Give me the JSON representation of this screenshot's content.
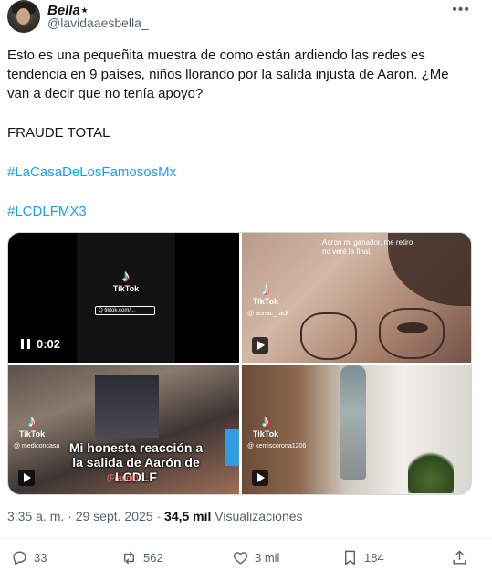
{
  "author": {
    "display_name": "Bella⋆",
    "handle": "@lavidaaesbella_"
  },
  "more_icon": "more-horizontal-icon",
  "tweet": {
    "line1": "Esto es una pequeñita muestra de como están ardiendo las redes es tendencia en 9 países, niños llorando por la salida injusta de Aaron. ¿Me van a decir que no tenía apoyo?",
    "line2": "FRAUDE TOTAL",
    "hashtag1": "#LaCasaDeLosFamososMx",
    "hashtag2": "#LCDLFMX3"
  },
  "media": {
    "tile1": {
      "brand": "TikTok",
      "search_text": "Q  tiktok.com/...",
      "time": "0:02"
    },
    "tile2": {
      "caption": "Aaron mi ganador, me retiro no veré la final.",
      "brand": "TikTok",
      "user": "@ annac_rack"
    },
    "tile3": {
      "brand": "TikTok",
      "user": "@ mediconcasa",
      "overlay": "Mi honesta reacción a la salida de Aarón de LCDLF",
      "sub": "(Fraude)"
    },
    "tile4": {
      "brand": "TikTok",
      "user": "@ kemiscorona1206"
    }
  },
  "meta": {
    "time": "3:35 a. m.",
    "sep": " · ",
    "date": "29 sept. 2025",
    "sep2": " · ",
    "views": "34,5 mil",
    "views_label": " Visualizaciones"
  },
  "actions": {
    "replies": "33",
    "retweets": "562",
    "likes": "3 mil",
    "bookmarks": "184"
  },
  "colors": {
    "text": "#0f1419",
    "secondary": "#536471",
    "link": "#1d9bf0"
  }
}
